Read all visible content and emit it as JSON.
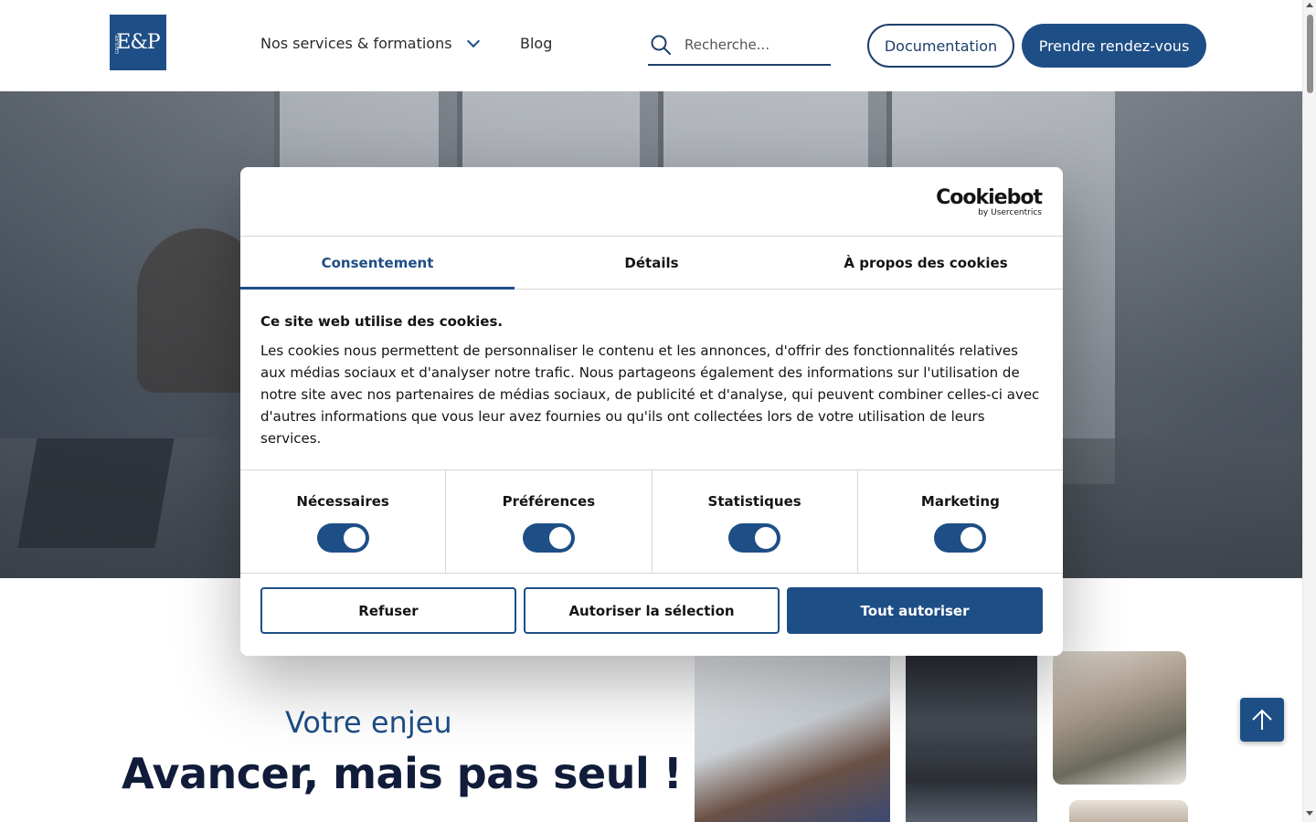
{
  "header": {
    "logo_text": "E&P",
    "logo_side_text": "GROUPE",
    "nav": {
      "services_label": "Nos services & formations",
      "blog_label": "Blog"
    },
    "search": {
      "placeholder": "Recherche...",
      "value": ""
    },
    "documentation_label": "Documentation",
    "appointment_label": "Prendre rendez-vous"
  },
  "cookie_dialog": {
    "brand": "Cookiebot",
    "brand_sub": "by Usercentrics",
    "tabs": [
      {
        "label": "Consentement",
        "active": true
      },
      {
        "label": "Détails",
        "active": false
      },
      {
        "label": "À propos des cookies",
        "active": false
      }
    ],
    "heading": "Ce site web utilise des cookies.",
    "body": "Les cookies nous permettent de personnaliser le contenu et les annonces, d'offrir des fonctionnalités relatives aux médias sociaux et d'analyser notre trafic. Nous partageons également des informations sur l'utilisation de notre site avec nos partenaires de médias sociaux, de publicité et d'analyse, qui peuvent combiner celles-ci avec d'autres informations que vous leur avez fournies ou qu'ils ont collectées lors de votre utilisation de leurs services.",
    "toggles": [
      {
        "label": "Nécessaires",
        "on": true
      },
      {
        "label": "Préférences",
        "on": true
      },
      {
        "label": "Statistiques",
        "on": true
      },
      {
        "label": "Marketing",
        "on": true
      }
    ],
    "buttons": {
      "refuse": "Refuser",
      "allow_selection": "Autoriser la sélection",
      "allow_all": "Tout autoriser"
    }
  },
  "section": {
    "subtitle": "Votre enjeu",
    "title": "Avancer, mais pas seul !"
  },
  "colors": {
    "brand_blue": "#1e4e86",
    "dark_navy": "#101c3a"
  }
}
